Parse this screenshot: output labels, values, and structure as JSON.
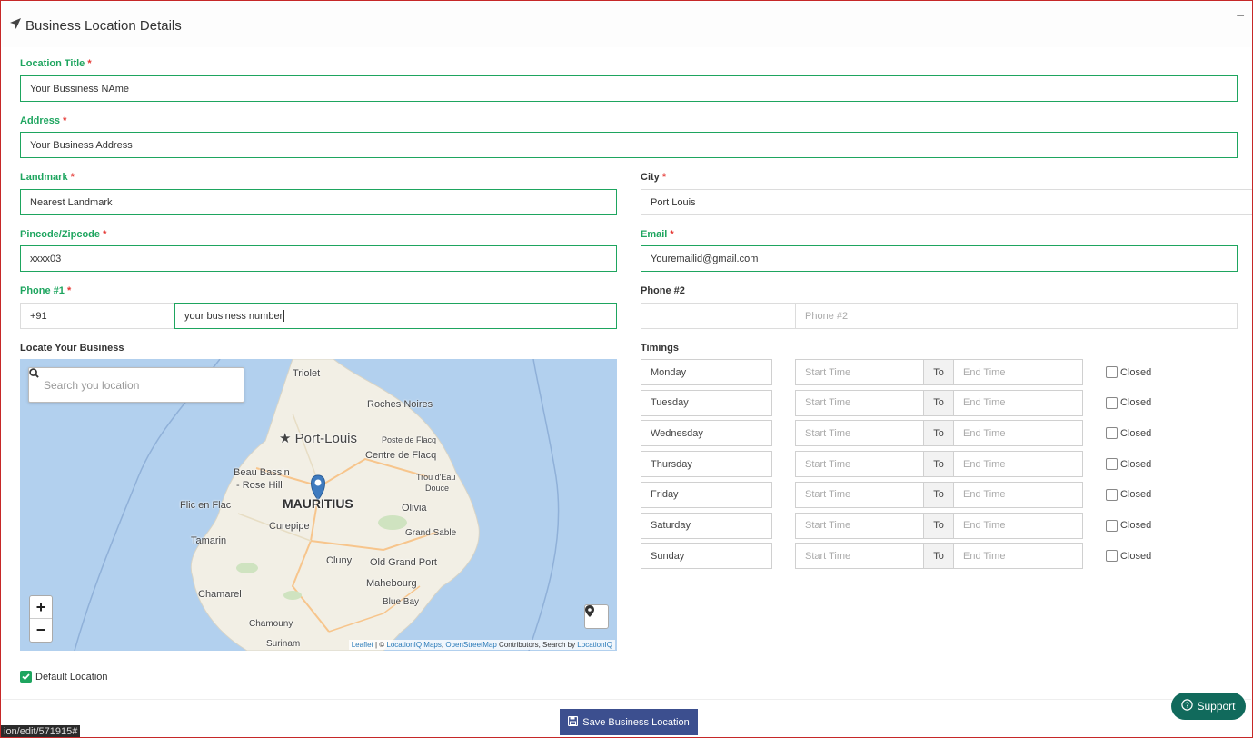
{
  "header": {
    "title": "Business Location Details",
    "collapse_symbol": "–"
  },
  "form": {
    "location_title": {
      "label": "Location Title",
      "value": "Your Bussiness NAme"
    },
    "address": {
      "label": "Address",
      "value": "Your Business Address"
    },
    "landmark": {
      "label": "Landmark",
      "value": "Nearest Landmark"
    },
    "city": {
      "label": "City",
      "value": "Port Louis"
    },
    "pincode": {
      "label": "Pincode/Zipcode",
      "value": "xxxx03"
    },
    "email": {
      "label": "Email",
      "value": "Youremailid@gmail.com"
    },
    "phone1": {
      "label": "Phone #1",
      "code": "+91",
      "value": "your business number"
    },
    "phone2": {
      "label": "Phone #2",
      "code": "",
      "placeholder": "Phone #2"
    },
    "required_mark": "*"
  },
  "map": {
    "section_label": "Locate Your Business",
    "search_placeholder": "Search you location",
    "zoom_in": "+",
    "zoom_out": "−",
    "attribution": {
      "leaflet": "Leaflet",
      "sep1": " | © ",
      "locationiq_maps": "LocationIQ Maps",
      "sep2": ", ",
      "osm": "OpenStreetMap",
      "contrib": " Contributors, Search by ",
      "locationiq": "LocationIQ"
    },
    "places": [
      "Triolet",
      "Roches Noires",
      "Port-Louis",
      "Poste de Flacq",
      "Centre de Flacq",
      "Beau Bassin",
      "- Rose Hill",
      "Trou d'Eau",
      "Douce",
      "Flic en Flac",
      "MAURITIUS",
      "Olivia",
      "Curepipe",
      "Grand Sable",
      "Tamarin",
      "Cluny",
      "Old Grand Port",
      "Mahebourg",
      "Chamarel",
      "Blue Bay",
      "Chamouny",
      "Surinam"
    ]
  },
  "timings": {
    "label": "Timings",
    "start_placeholder": "Start Time",
    "to_label": "To",
    "end_placeholder": "End Time",
    "closed_label": "Closed",
    "days": [
      "Monday",
      "Tuesday",
      "Wednesday",
      "Thursday",
      "Friday",
      "Saturday",
      "Sunday"
    ]
  },
  "default_location": {
    "label": "Default Location",
    "checked": true
  },
  "save_button": "Save Business Location",
  "support_button": "Support",
  "status_url": "ion/edit/571915#",
  "colors": {
    "accent_green": "#1ea55f",
    "save_blue": "#3c4f8f",
    "support_teal": "#116a5c",
    "map_water": "#b2d0ee",
    "map_land": "#f2efe5"
  }
}
